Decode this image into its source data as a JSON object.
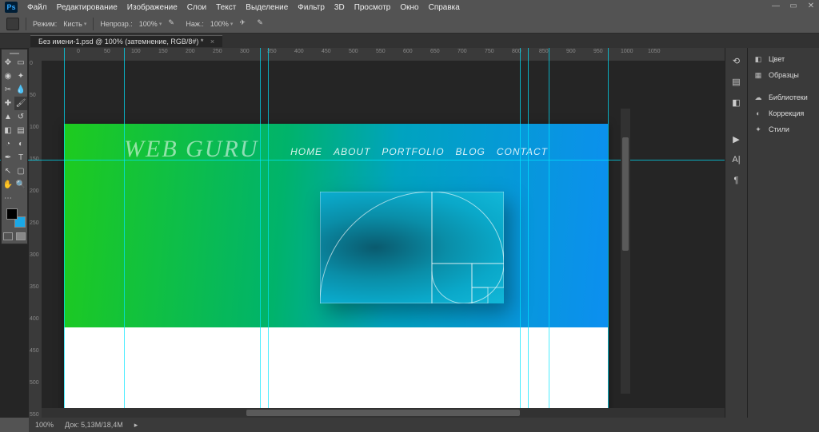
{
  "app": {
    "logo": "Ps"
  },
  "menu": [
    "Файл",
    "Редактирование",
    "Изображение",
    "Слои",
    "Текст",
    "Выделение",
    "Фильтр",
    "3D",
    "Просмотр",
    "Окно",
    "Справка"
  ],
  "options": {
    "mode_label": "Режим:",
    "mode_value": "Кисть",
    "preset_value": "Непрозр.:",
    "opacity": "100%",
    "flow_label": "Наж.:",
    "flow": "100%"
  },
  "tab": {
    "title": "Без имени-1.psd @ 100% (затемнение, RGB/8#) *"
  },
  "rulers_h": [
    0,
    50,
    100,
    150,
    200,
    250,
    300,
    350,
    400,
    450,
    500,
    550,
    600,
    650,
    700,
    750,
    800,
    850,
    900,
    950,
    1000,
    1050
  ],
  "rulers_v": [
    0,
    50,
    100,
    150,
    200,
    250,
    300,
    350,
    400,
    450,
    500,
    550
  ],
  "canvas_design": {
    "brand": "WEB GURU",
    "nav": [
      "HOME",
      "ABOUT",
      "PORTFOLIO",
      "BLOG",
      "CONTACT"
    ]
  },
  "panels": {
    "color": "Цвет",
    "swatches": "Образцы",
    "libraries": "Библиотеки",
    "adjustments": "Коррекция",
    "styles": "Стили"
  },
  "status": {
    "zoom": "100%",
    "doc": "Док: 5,13M/18,4M"
  }
}
